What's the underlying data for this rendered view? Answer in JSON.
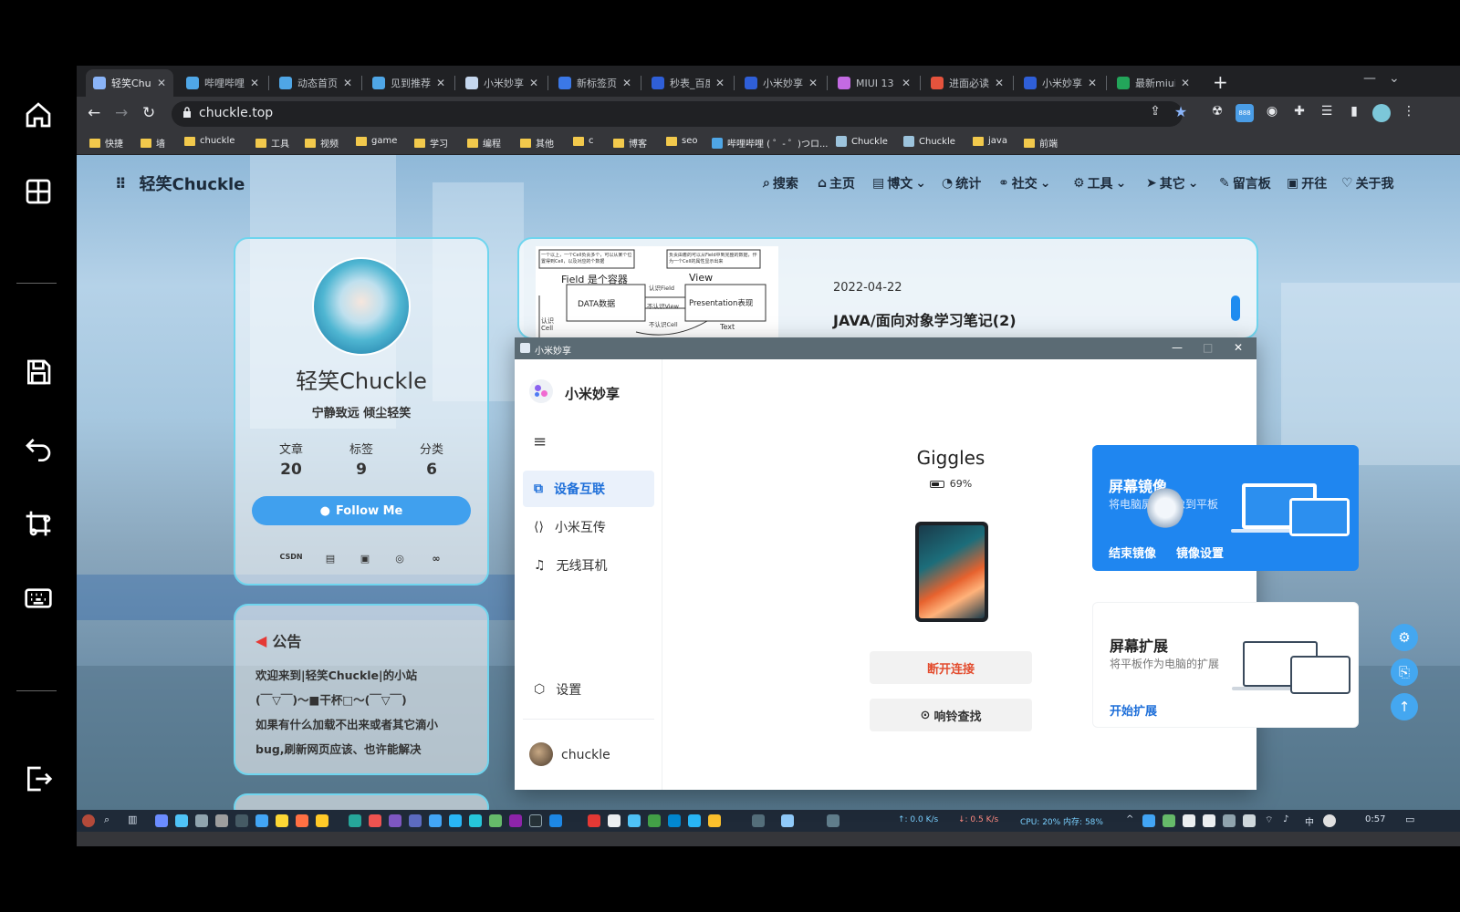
{
  "browser": {
    "tabs": [
      {
        "label": "轻笑Chuckle",
        "color": "#8ab4f8"
      },
      {
        "label": "哔哩哔哩",
        "color": "#4fa6e6"
      },
      {
        "label": "动态首页",
        "color": "#4fa6e6"
      },
      {
        "label": "见到推荐",
        "color": "#4fa6e6"
      },
      {
        "label": "小米妙享",
        "color": "#c5d7ee"
      },
      {
        "label": "新标签页",
        "color": "#3b78e7"
      },
      {
        "label": "秒表_百度",
        "color": "#2f5fd8"
      },
      {
        "label": "小米妙享",
        "color": "#2f5fd8"
      },
      {
        "label": "MIUI 13",
        "color": "#c36ae2"
      },
      {
        "label": "进面必读",
        "color": "#e5533d"
      },
      {
        "label": "小米妙享",
        "color": "#2f5fd8"
      },
      {
        "label": "最新miui",
        "color": "#23a55a"
      }
    ],
    "url": "chuckle.top",
    "bookmarks": [
      {
        "label": "快捷",
        "type": "folder"
      },
      {
        "label": "墙",
        "type": "folder"
      },
      {
        "label": "chuckle",
        "type": "folder"
      },
      {
        "label": "工具",
        "type": "folder"
      },
      {
        "label": "视频",
        "type": "folder"
      },
      {
        "label": "game",
        "type": "folder"
      },
      {
        "label": "学习",
        "type": "folder"
      },
      {
        "label": "编程",
        "type": "folder"
      },
      {
        "label": "其他",
        "type": "folder"
      },
      {
        "label": "c",
        "type": "folder"
      },
      {
        "label": "博客",
        "type": "folder"
      },
      {
        "label": "seo",
        "type": "folder"
      },
      {
        "label": "哔哩哔哩 ( ゜- ゜)つロ...",
        "type": "site"
      },
      {
        "label": "Chuckle",
        "type": "site"
      },
      {
        "label": "Chuckle",
        "type": "site"
      },
      {
        "label": "java",
        "type": "folder"
      },
      {
        "label": "前端",
        "type": "folder"
      }
    ]
  },
  "site": {
    "logo": "轻笑Chuckle",
    "nav": [
      {
        "label": "搜索",
        "icon": "search-icon",
        "caret": false
      },
      {
        "label": "主页",
        "icon": "home-icon",
        "caret": false
      },
      {
        "label": "博文",
        "icon": "book-icon",
        "caret": true
      },
      {
        "label": "统计",
        "icon": "chart-icon",
        "caret": false
      },
      {
        "label": "社交",
        "icon": "link-icon",
        "caret": true
      },
      {
        "label": "工具",
        "icon": "gear-icon",
        "caret": true
      },
      {
        "label": "其它",
        "icon": "send-icon",
        "caret": true
      },
      {
        "label": "留言板",
        "icon": "edit-icon",
        "caret": false
      },
      {
        "label": "开往",
        "icon": "train-icon",
        "caret": false
      },
      {
        "label": "关于我",
        "icon": "heart-icon",
        "caret": false
      }
    ],
    "author": {
      "name": "轻笑Chuckle",
      "motto": "宁静致远 倾尘轻笑",
      "stats": [
        {
          "label": "文章",
          "value": "20"
        },
        {
          "label": "标签",
          "value": "9"
        },
        {
          "label": "分类",
          "value": "6"
        }
      ],
      "follow": "Follow Me",
      "social": [
        "CSDN",
        "博客园",
        "bilibili",
        "网易云",
        "cnblogs"
      ]
    },
    "notice": {
      "title": "公告",
      "lines": [
        "欢迎来到|轻笑Chuckle|的小站",
        "(￣▽￣)～■干杯□～(￣▽￣)",
        "如果有什么加载不出来或者其它滴小",
        "bug,刷新网页应该、也许能解决"
      ]
    },
    "post": {
      "date": "2022-04-22",
      "title": "JAVA/面向对象学习笔记(2)",
      "diagram": {
        "note_left": "一个以上，一个Cell负责多个，可以从某个位置得到Cell，以及对应的个数据",
        "note_right": "负责由着的可以从Field中到完整的数据，作为一个Cell的属性显示出来",
        "field": "Field 是个容器",
        "view": "View",
        "data_box": "DATA数据",
        "presentation_box": "Presentation表现",
        "arrow_top": "认识Field",
        "arrow_mid": "不认识View",
        "arrow_bottom": "不认识Cell",
        "left_label": "认识Cell",
        "text_label": "Text"
      }
    }
  },
  "app": {
    "window_title": "小米妙享",
    "brand": "小米妙享",
    "menu": [
      {
        "label": "设备互联",
        "active": true
      },
      {
        "label": "小米互传",
        "active": false
      },
      {
        "label": "无线耳机",
        "active": false
      }
    ],
    "settings": "设置",
    "user": "chuckle",
    "device": {
      "name": "Giggles",
      "battery": "69%",
      "battery_fraction": 0.69
    },
    "disconnect": "断开连接",
    "ring": "响铃查找",
    "mirror": {
      "title": "屏幕镜像",
      "desc": "将电脑屏幕镜像到平板",
      "end": "结束镜像",
      "settings": "镜像设置"
    },
    "extend": {
      "title": "屏幕扩展",
      "desc": "将平板作为电脑的扩展",
      "start": "开始扩展"
    }
  },
  "taskbar": {
    "net_up": "↑: 0.0 K/s",
    "net_down": "↓: 0.5 K/s",
    "cpu": "CPU: 20% 内存: 58%",
    "ime": "中",
    "clock": "0:57"
  },
  "colors": {
    "accent_blue": "#1e6fd9",
    "card_border": "#6fd5ee",
    "mirror_card": "#1f86f0",
    "disconnect_red": "#e34d2f"
  }
}
